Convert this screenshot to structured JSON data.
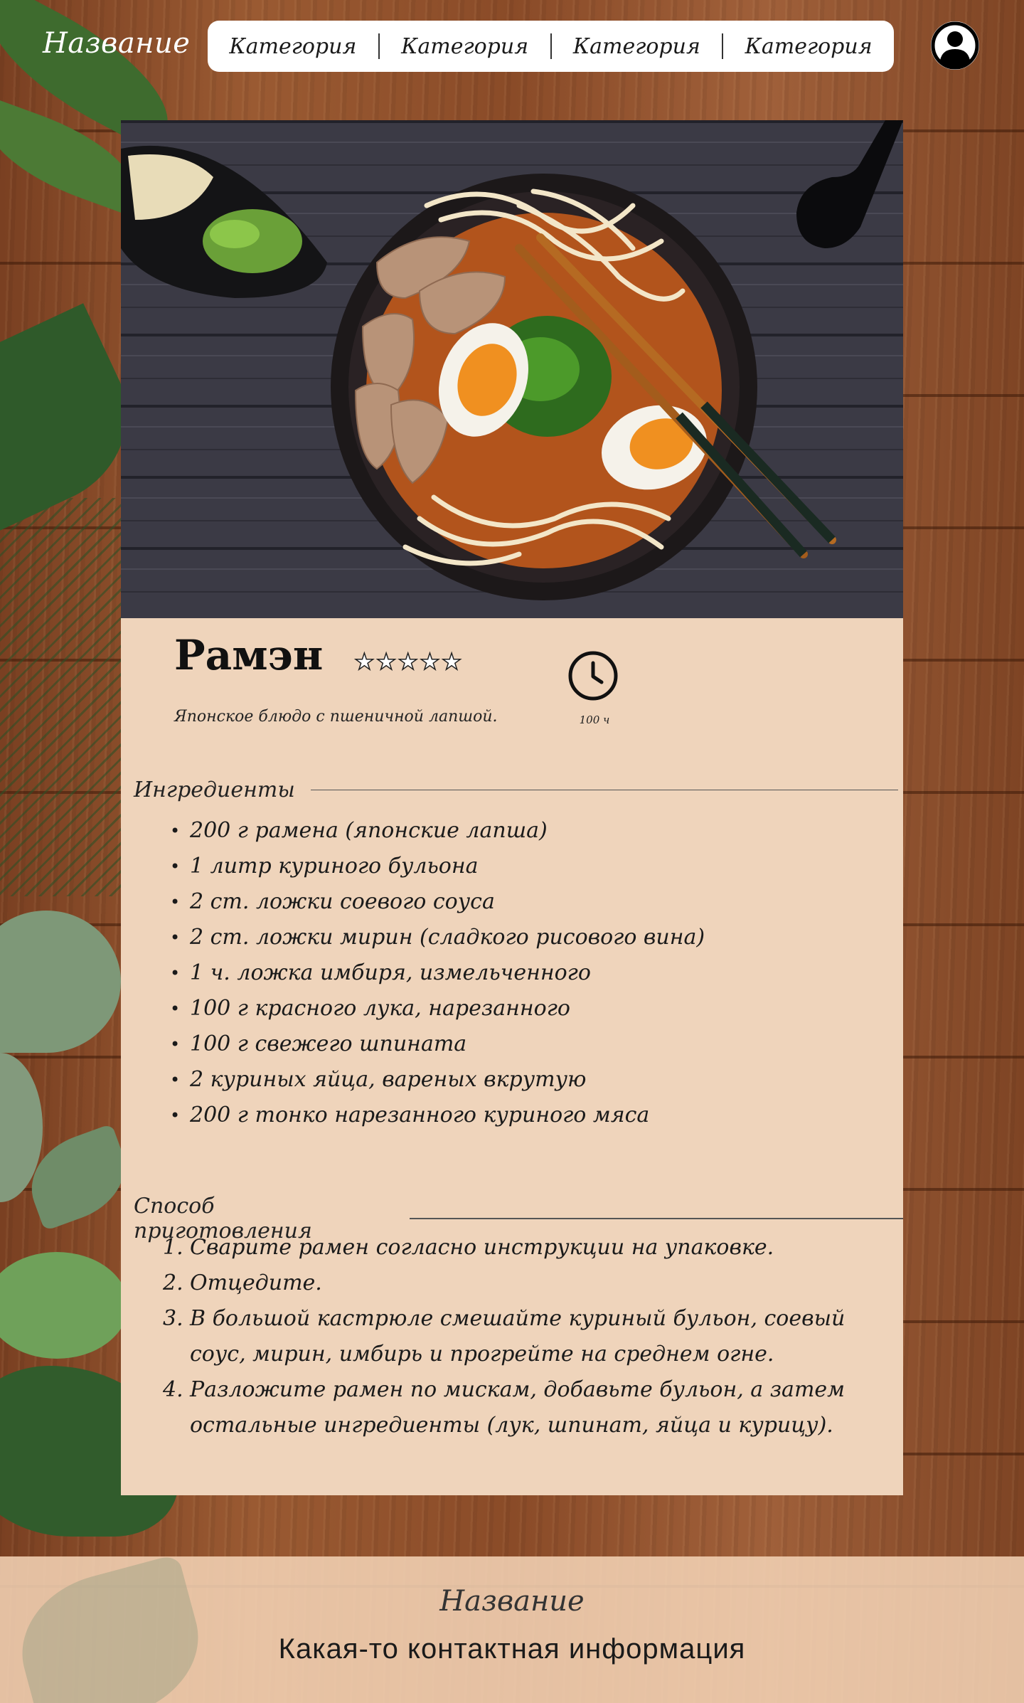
{
  "header": {
    "brand": "Название",
    "nav": [
      {
        "label": "Категория"
      },
      {
        "label": "Категория"
      },
      {
        "label": "Категория"
      },
      {
        "label": "Категория"
      }
    ]
  },
  "icons": {
    "avatar": "user-avatar-icon",
    "clock": "clock-icon",
    "rating_star": "star-outline-icon"
  },
  "recipe": {
    "title": "Рамэн",
    "rating": {
      "value": 0,
      "max": 5
    },
    "description": "Японское блюдо с пшеничной лапшой.",
    "time": "100 ч",
    "ingredients_heading": "Ингредиенты",
    "ingredients": [
      "200 г рамена (японские лапша)",
      "1 литр куриного бульона",
      "2 ст. ложки соевого соуса",
      "2 ст. ложки мирин (сладкого рисового вина)",
      "1 ч. ложка имбиря, измельченного",
      "100 г красного лука, нарезанного",
      "100 г свежего шпината",
      "2 куриных яйца, вареных вкрутую",
      "200 г тонко нарезанного куриного мяса"
    ],
    "method_heading": "Способ приготовления",
    "steps": [
      "Сварите рамен согласно инструкции на упаковке.",
      "Отцедите.",
      "В большой кастрюле смешайте куриный бульон, соевый соус, мирин, имбирь и прогрейте на среднем огне.",
      "Разложите рамен по мискам, добавьте бульон, а затем остальные ингредиенты (лук, шпинат, яйца и курицу)."
    ]
  },
  "footer": {
    "title": "Название",
    "contact": "Какая-то контактная информация"
  },
  "colors": {
    "card_background": "#efd4bb",
    "nav_background": "#ffffff",
    "text": "#1a1a1a",
    "wood": "#8a4b28"
  }
}
